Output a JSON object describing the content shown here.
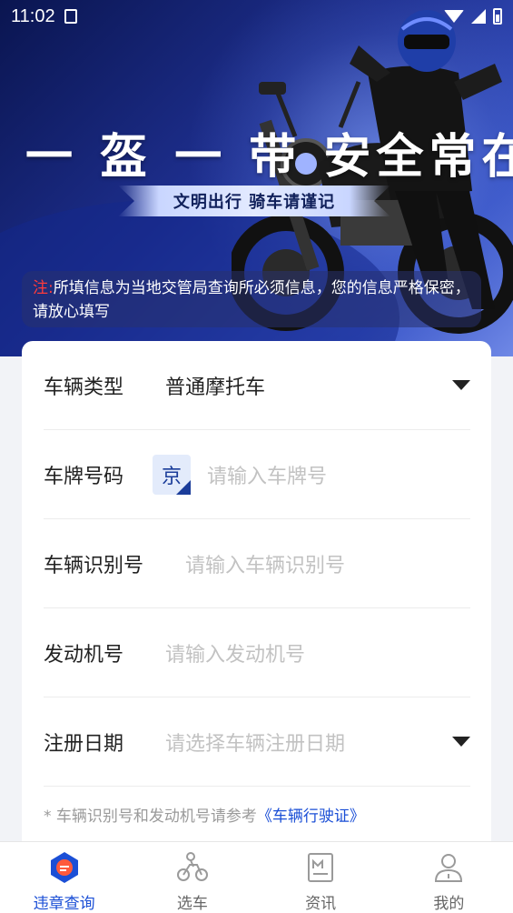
{
  "status_bar": {
    "time": "11:02"
  },
  "banner": {
    "slogan": "一 盔 一 带  安全常在",
    "ribbon": "文明出行  骑车请谨记",
    "notice_label": "注:",
    "notice_text": "所填信息为当地交管局查询所必须信息，您的信息严格保密，请放心填写"
  },
  "form": {
    "vehicle_type": {
      "label": "车辆类型",
      "value": "普通摩托车"
    },
    "plate": {
      "label": "车牌号码",
      "prefix": "京",
      "placeholder": "请输入车牌号"
    },
    "vin": {
      "label": "车辆识别号",
      "placeholder": "请输入车辆识别号"
    },
    "engine": {
      "label": "发动机号",
      "placeholder": "请输入发动机号"
    },
    "reg_date": {
      "label": "注册日期",
      "placeholder": "请选择车辆注册日期"
    },
    "footnote": "* 车辆识别号和发动机号请参考",
    "footnote_link": "《车辆行驶证》"
  },
  "tabbar": {
    "items": [
      {
        "label": "违章查询",
        "icon": "violation-query-icon",
        "active": true
      },
      {
        "label": "选车",
        "icon": "motorcycle-icon",
        "active": false
      },
      {
        "label": "资讯",
        "icon": "news-icon",
        "active": false
      },
      {
        "label": "我的",
        "icon": "profile-icon",
        "active": false
      }
    ]
  },
  "colors": {
    "accent": "#1b4fd6",
    "notice_label": "#ff3b3b",
    "banner_dark": "#0a1550"
  }
}
